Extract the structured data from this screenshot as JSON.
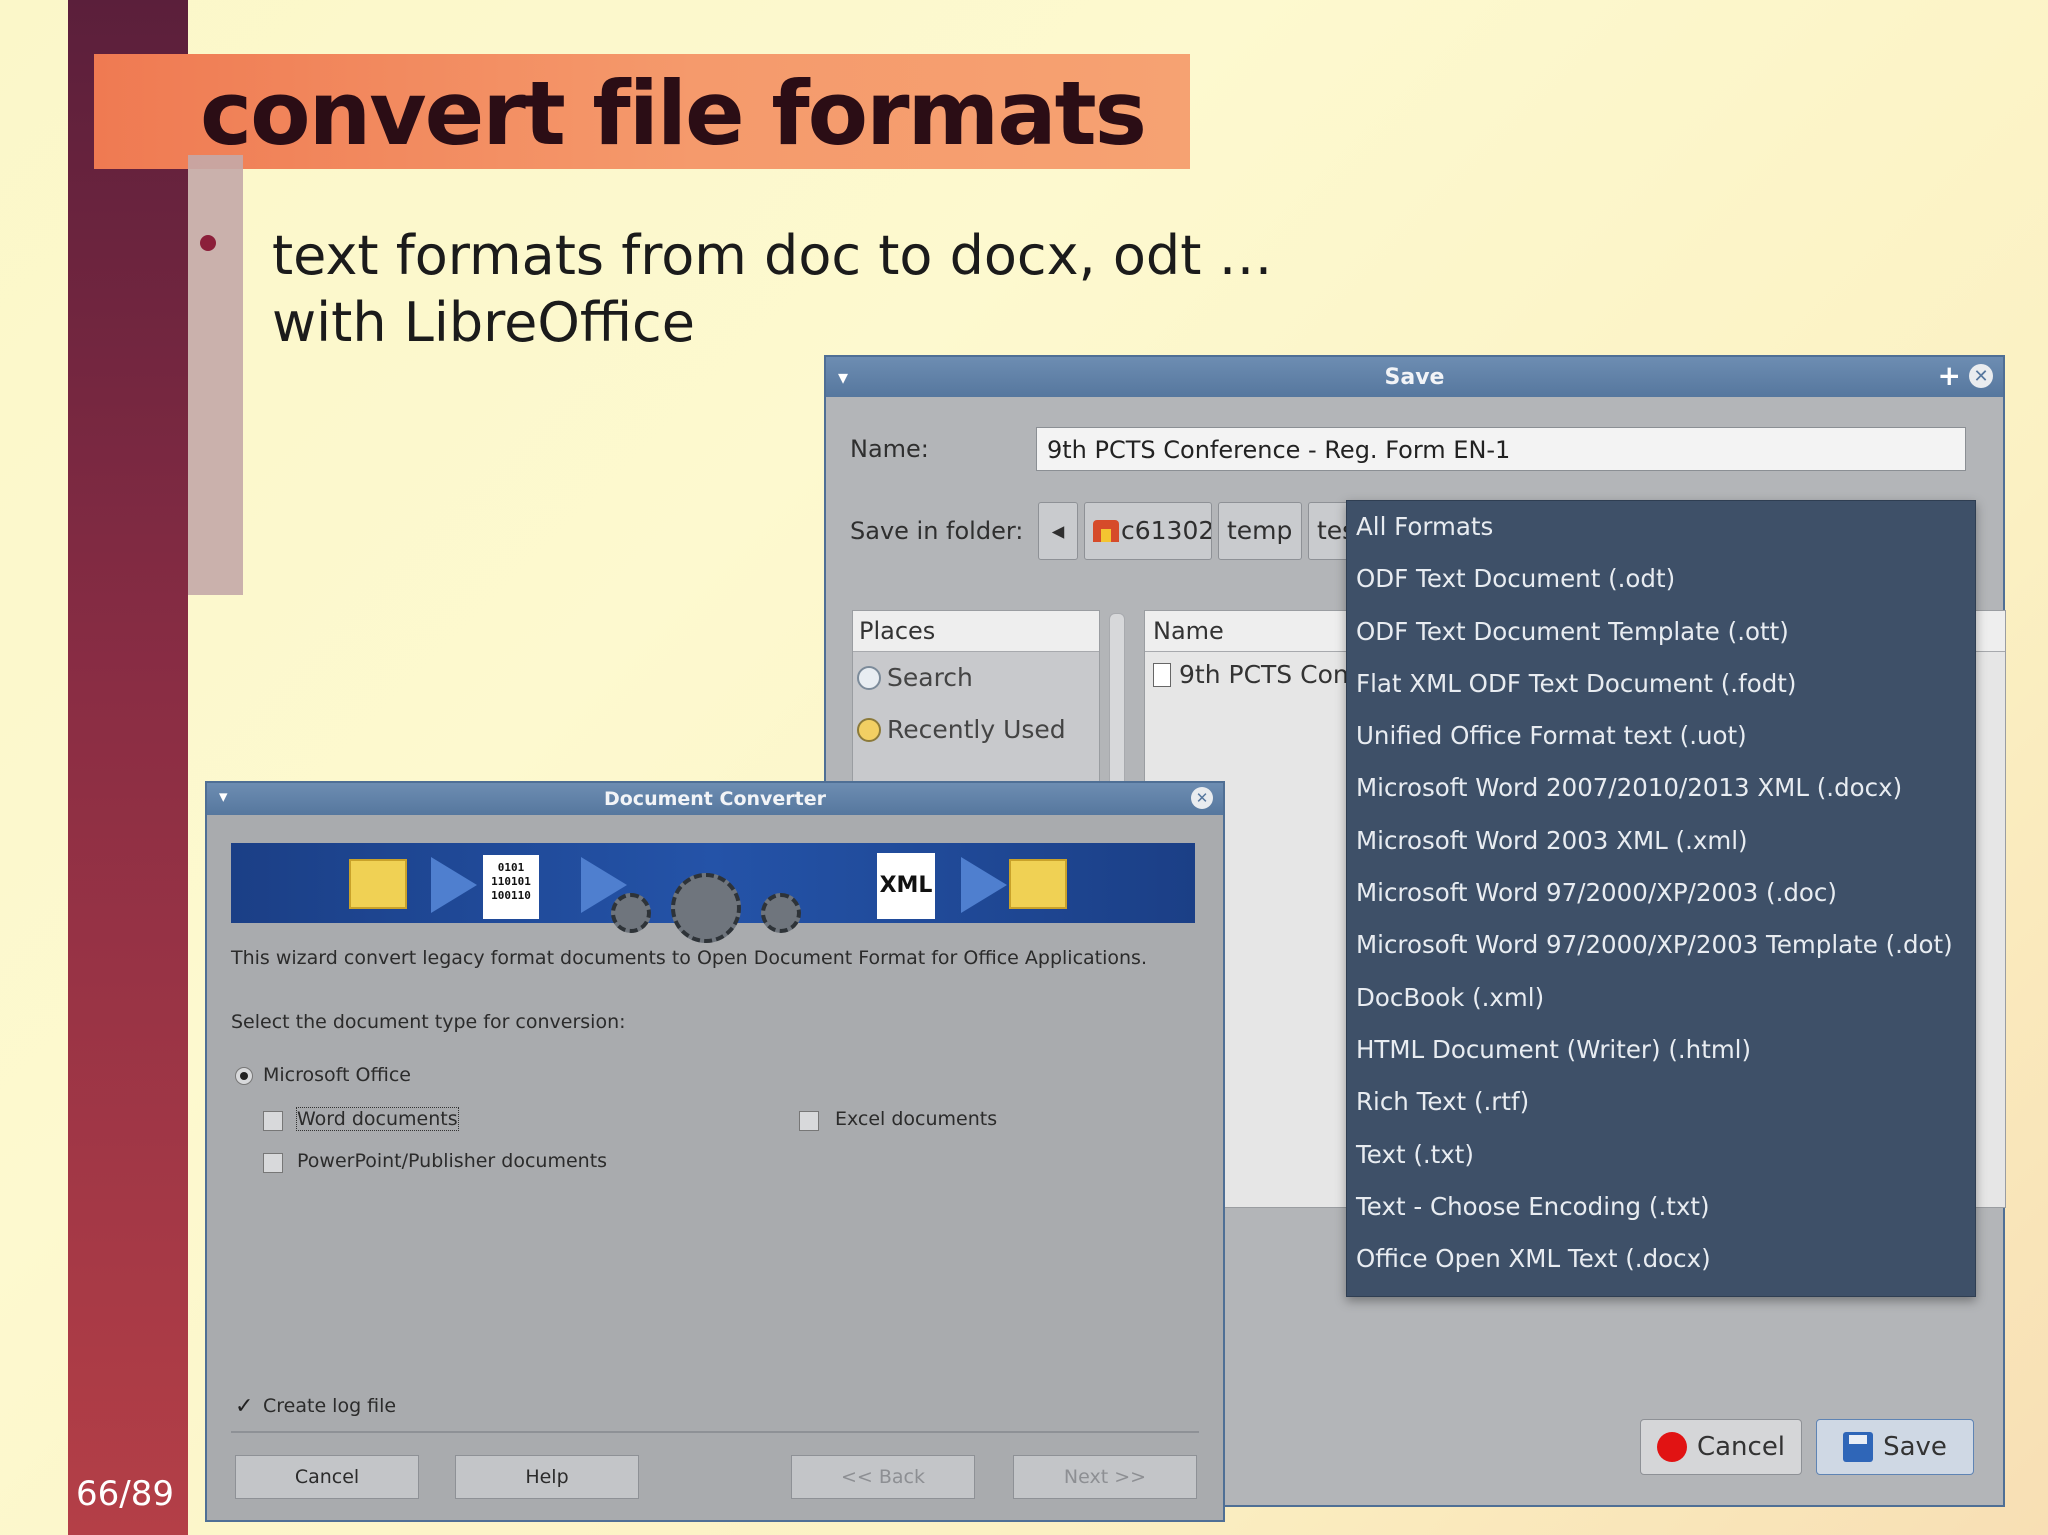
{
  "slide": {
    "title": "convert file formats",
    "bullet_line1": "text formats from doc to docx, odt …",
    "bullet_line2": "with LibreOffice",
    "page_number": "66/89"
  },
  "save_dialog": {
    "title": "Save",
    "name_label": "Name:",
    "name_value": "9th PCTS Conference - Reg. Form EN-1",
    "folder_label": "Save in folder:",
    "breadcrumbs": [
      "c61302",
      "temp",
      "tes"
    ],
    "places_header": "Places",
    "places": [
      "Search",
      "Recently Used"
    ],
    "files_header": "Name",
    "files": [
      "9th PCTS Con"
    ],
    "cancel_label": "Cancel",
    "save_label": "Save"
  },
  "format_dropdown": {
    "items": [
      "All Formats",
      "ODF Text Document (.odt)",
      "ODF Text Document Template (.ott)",
      "Flat XML ODF Text Document (.fodt)",
      "Unified Office Format text (.uot)",
      "Microsoft Word 2007/2010/2013 XML (.docx)",
      "Microsoft Word 2003 XML (.xml)",
      "Microsoft Word 97/2000/XP/2003 (.doc)",
      "Microsoft Word 97/2000/XP/2003 Template (.dot)",
      "DocBook (.xml)",
      "HTML Document (Writer) (.html)",
      "Rich Text (.rtf)",
      "Text (.txt)",
      "Text - Choose Encoding (.txt)",
      "Office Open XML Text (.docx)"
    ]
  },
  "converter": {
    "title": "Document Converter",
    "banner_binary": "0101\n110101\n100110",
    "banner_xml": "XML",
    "description": "This wizard convert legacy format documents to Open Document Format for Office Applications.",
    "select_label": "Select the document type for conversion:",
    "radio_ms_office": "Microsoft Office",
    "word_docs": "Word documents",
    "excel_docs": "Excel documents",
    "ppt_docs": "PowerPoint/Publisher documents",
    "log_file": "Create log file",
    "btn_cancel": "Cancel",
    "btn_help": "Help",
    "btn_back": "<< Back",
    "btn_next": "Next >>"
  },
  "colors": {
    "window_title": "#56779e",
    "dropdown_bg": "#3e5068",
    "title_bar": "#f59a6c",
    "slide_band": "#8a2d44"
  }
}
